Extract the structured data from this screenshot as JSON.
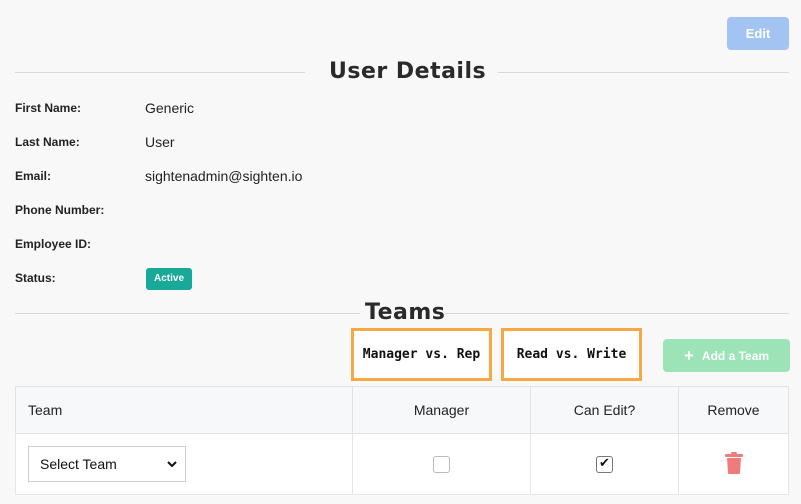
{
  "toolbar": {
    "edit_label": "Edit"
  },
  "user_details": {
    "title": "User Details",
    "fields": [
      {
        "label": "First Name:",
        "value": "Generic"
      },
      {
        "label": "Last Name:",
        "value": "User"
      },
      {
        "label": "Email:",
        "value": "sightenadmin@sighten.io"
      },
      {
        "label": "Phone Number:",
        "value": ""
      },
      {
        "label": "Employee ID:",
        "value": ""
      },
      {
        "label": "Status:",
        "value": ""
      }
    ],
    "status_badge": "Active",
    "colors": {
      "status_active": "#18a999",
      "edit_button": "#a3c4f3"
    }
  },
  "teams": {
    "title": "Teams",
    "annotations": [
      "Manager vs. Rep",
      "Read vs. Write"
    ],
    "add_team_label": "Add a Team",
    "add_team_icon": "plus-icon",
    "columns": [
      "Team",
      "Manager",
      "Can Edit?",
      "Remove"
    ],
    "rows": [
      {
        "team_select": "Select Team",
        "manager": false,
        "can_edit": true,
        "remove_icon": "trash-icon"
      }
    ],
    "colors": {
      "annotation_border": "#f7a842",
      "add_button": "#9de3b8",
      "remove_icon": "#f07b7b"
    }
  }
}
